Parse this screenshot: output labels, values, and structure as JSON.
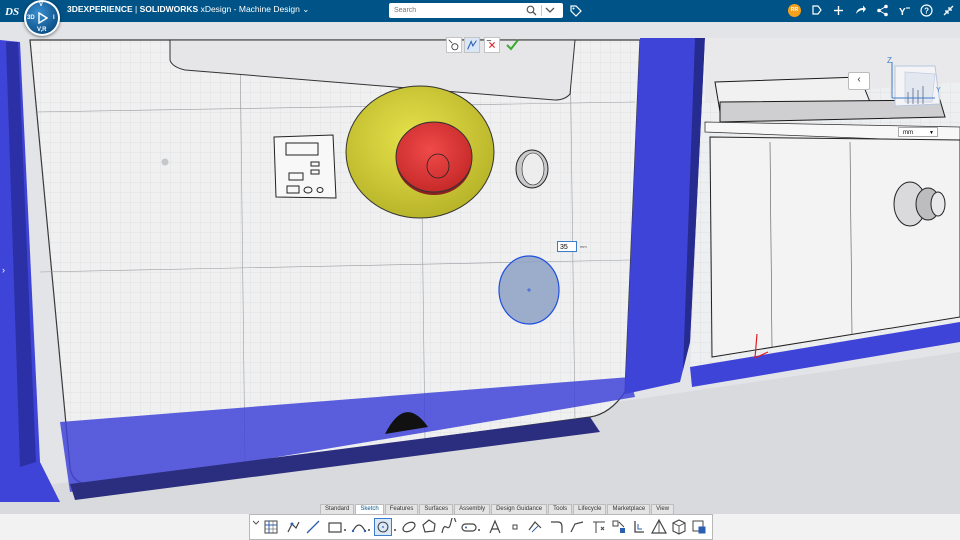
{
  "header": {
    "brand": "3DEXPERIENCE",
    "product": "SOLIDWORKS",
    "app": "xDesign",
    "document": "Machine Design",
    "user_initials": "RR"
  },
  "compass": {
    "top": "V",
    "left": "3D",
    "right": "I",
    "bottom": "V,R"
  },
  "search": {
    "placeholder": "Search"
  },
  "viewport": {
    "dimension_value": "35",
    "dimension_unit": "mm",
    "units": "mm"
  },
  "tabs": [
    "Standard",
    "Sketch",
    "Features",
    "Surfaces",
    "Assembly",
    "Design Guidance",
    "Tools",
    "Lifecycle",
    "Marketplace",
    "View"
  ],
  "active_tab": "Sketch",
  "axis": {
    "z": "Z",
    "y": "Y"
  },
  "colors": {
    "header": "#005386",
    "accent": "#3d7cc9",
    "frame_blue": "#3f44d8",
    "button_yellow": "#d6d33c",
    "button_red": "#e63c3c"
  }
}
